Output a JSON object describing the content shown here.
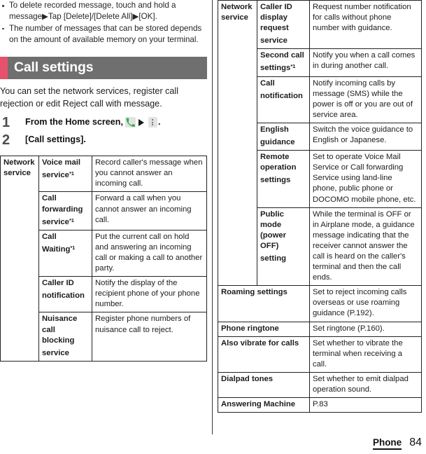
{
  "notes": [
    "To delete recorded message, touch and hold a message▶Tap [Delete]/[Delete All]▶[OK].",
    "The number of messages that can be stored depends on the amount of available memory on your terminal."
  ],
  "section": {
    "title": "Call settings",
    "accent_color": "#e8516b",
    "band_color": "#6f6f6f",
    "intro": "You can set the network services, register call rejection or edit Reject call with message."
  },
  "steps": [
    {
      "number": "1",
      "text_before": "From the Home screen,",
      "icons": [
        "phone-icon",
        "arrow-right-icon",
        "overflow-menu-icon"
      ],
      "text_after": "."
    },
    {
      "number": "2",
      "text_before": "[Call settings].",
      "icons": [],
      "text_after": ""
    }
  ],
  "left_table": {
    "group_label": "Network service",
    "rows": [
      {
        "name": "Voice mail service",
        "footnote": "*1",
        "desc": "Record caller's message when you cannot answer an incoming call."
      },
      {
        "name": "Call forwarding service",
        "footnote": "*1",
        "desc": "Forward a call when you cannot answer an incoming call."
      },
      {
        "name": "Call Waiting",
        "footnote": "*1",
        "desc": "Put the current call on hold and answering an incoming call or making a call to another party."
      },
      {
        "name": "Caller ID notification",
        "footnote": "",
        "desc": "Notify the display of the recipient phone of your phone number."
      },
      {
        "name": "Nuisance call blocking service",
        "footnote": "",
        "desc": "Register phone numbers of nuisance call to reject."
      }
    ]
  },
  "right_table": {
    "group_label": "Network service",
    "grouped_rows": [
      {
        "name": "Caller ID display request service",
        "footnote": "",
        "desc": "Request number notification for calls without phone number with guidance."
      },
      {
        "name": "Second call settings",
        "footnote": "*1",
        "desc": "Notify you when a call comes in during another call."
      },
      {
        "name": "Call notification",
        "footnote": "",
        "desc": "Notify incoming calls by message (SMS) while the power is off or you are out of service area."
      },
      {
        "name": "English guidance",
        "footnote": "",
        "desc": "Switch the voice guidance to English or Japanese."
      },
      {
        "name": "Remote operation settings",
        "footnote": "",
        "desc": "Set to operate Voice Mail Service or Call forwarding Service using land-line phone, public phone or DOCOMO mobile phone, etc."
      },
      {
        "name": "Public mode (power OFF) setting",
        "footnote": "",
        "desc": "While the terminal is OFF or in Airplane mode, a guidance message indicating that the receiver cannot answer the call is heard on the caller's terminal and then the call ends."
      }
    ],
    "plain_rows": [
      {
        "name": "Roaming settings",
        "desc": "Set to reject incoming calls overseas or use roaming guidance (P.192)."
      },
      {
        "name": "Phone ringtone",
        "desc": "Set ringtone (P.160)."
      },
      {
        "name": "Also vibrate for calls",
        "desc": "Set whether to vibrate the terminal when receiving a call."
      },
      {
        "name": "Dialpad tones",
        "desc": "Set whether to emit dialpad operation sound."
      },
      {
        "name": "Answering Machine",
        "desc": "P.83"
      }
    ]
  },
  "footer": {
    "chapter": "Phone",
    "page_number": "84"
  }
}
